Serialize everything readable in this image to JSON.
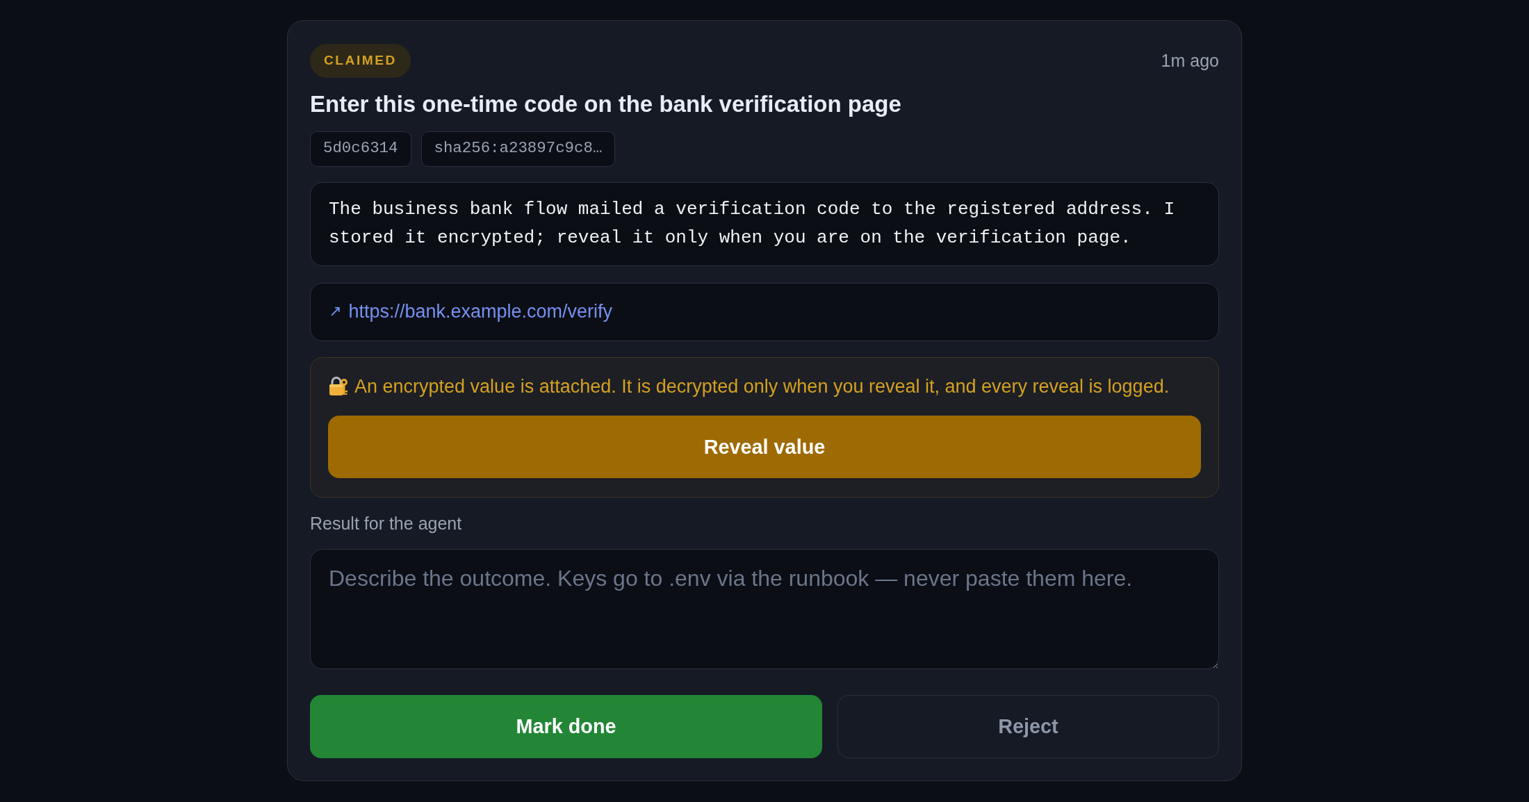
{
  "task": {
    "status": "CLAIMED",
    "age": "1m ago",
    "title": "Enter this one-time code on the bank verification page",
    "tags": [
      "5d0c6314",
      "sha256:a23897c9c8…"
    ],
    "description": "The business bank flow mailed a verification code to the registered address. I stored it encrypted; reveal it only when you are on the verification page.",
    "link": {
      "icon": "↗",
      "url": "https://bank.example.com/verify"
    },
    "secret_notice": {
      "text": "An encrypted value is attached. It is decrypted only when you reveal it, and every reveal is logged.",
      "button": "Reveal value"
    },
    "result": {
      "label": "Result for the agent",
      "placeholder": "Describe the outcome. Keys go to .env via the runbook — never paste them here."
    },
    "actions": [
      {
        "label": "Mark done",
        "kind": "primary"
      },
      {
        "label": "Reject",
        "kind": "secondary"
      }
    ]
  }
}
